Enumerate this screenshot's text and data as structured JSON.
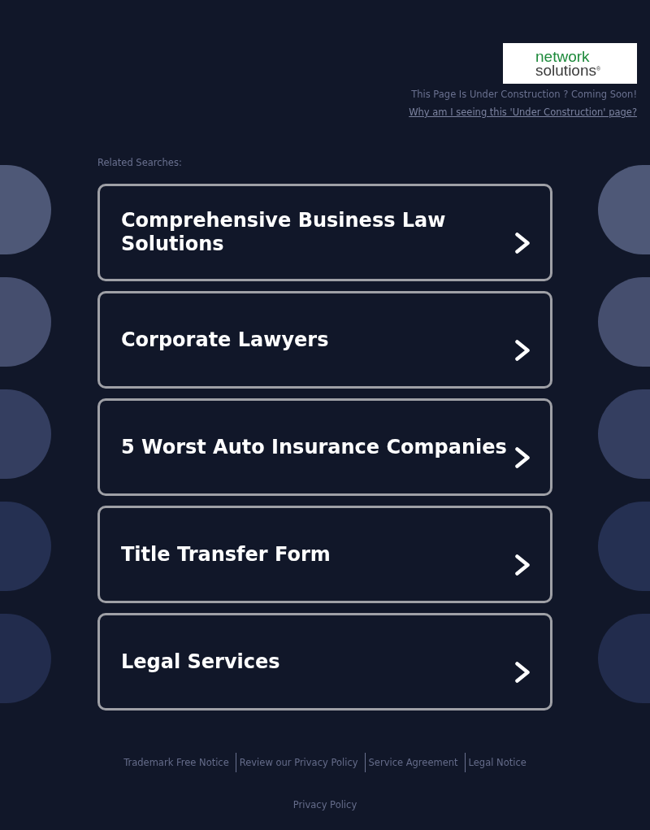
{
  "header": {
    "logo": {
      "top": "network",
      "bottom": "solutions$^{®}$"
    },
    "notice": "This Page Is Under Construction ? Coming Soon!",
    "help_link": "Why am I seeing this 'Under Construction' page?"
  },
  "related": {
    "heading": "Related Searches:",
    "items": [
      "Comprehensive Business Law Solutions",
      "Corporate Lawyers",
      "5 Worst Auto Insurance Companies",
      "Title Transfer Form",
      "Legal Services"
    ]
  },
  "footer": {
    "links": [
      "Trademark Free Notice",
      "Review our Privacy Policy",
      "Service Agreement",
      "Legal Notice"
    ],
    "privacy_link": "Privacy Policy"
  }
}
